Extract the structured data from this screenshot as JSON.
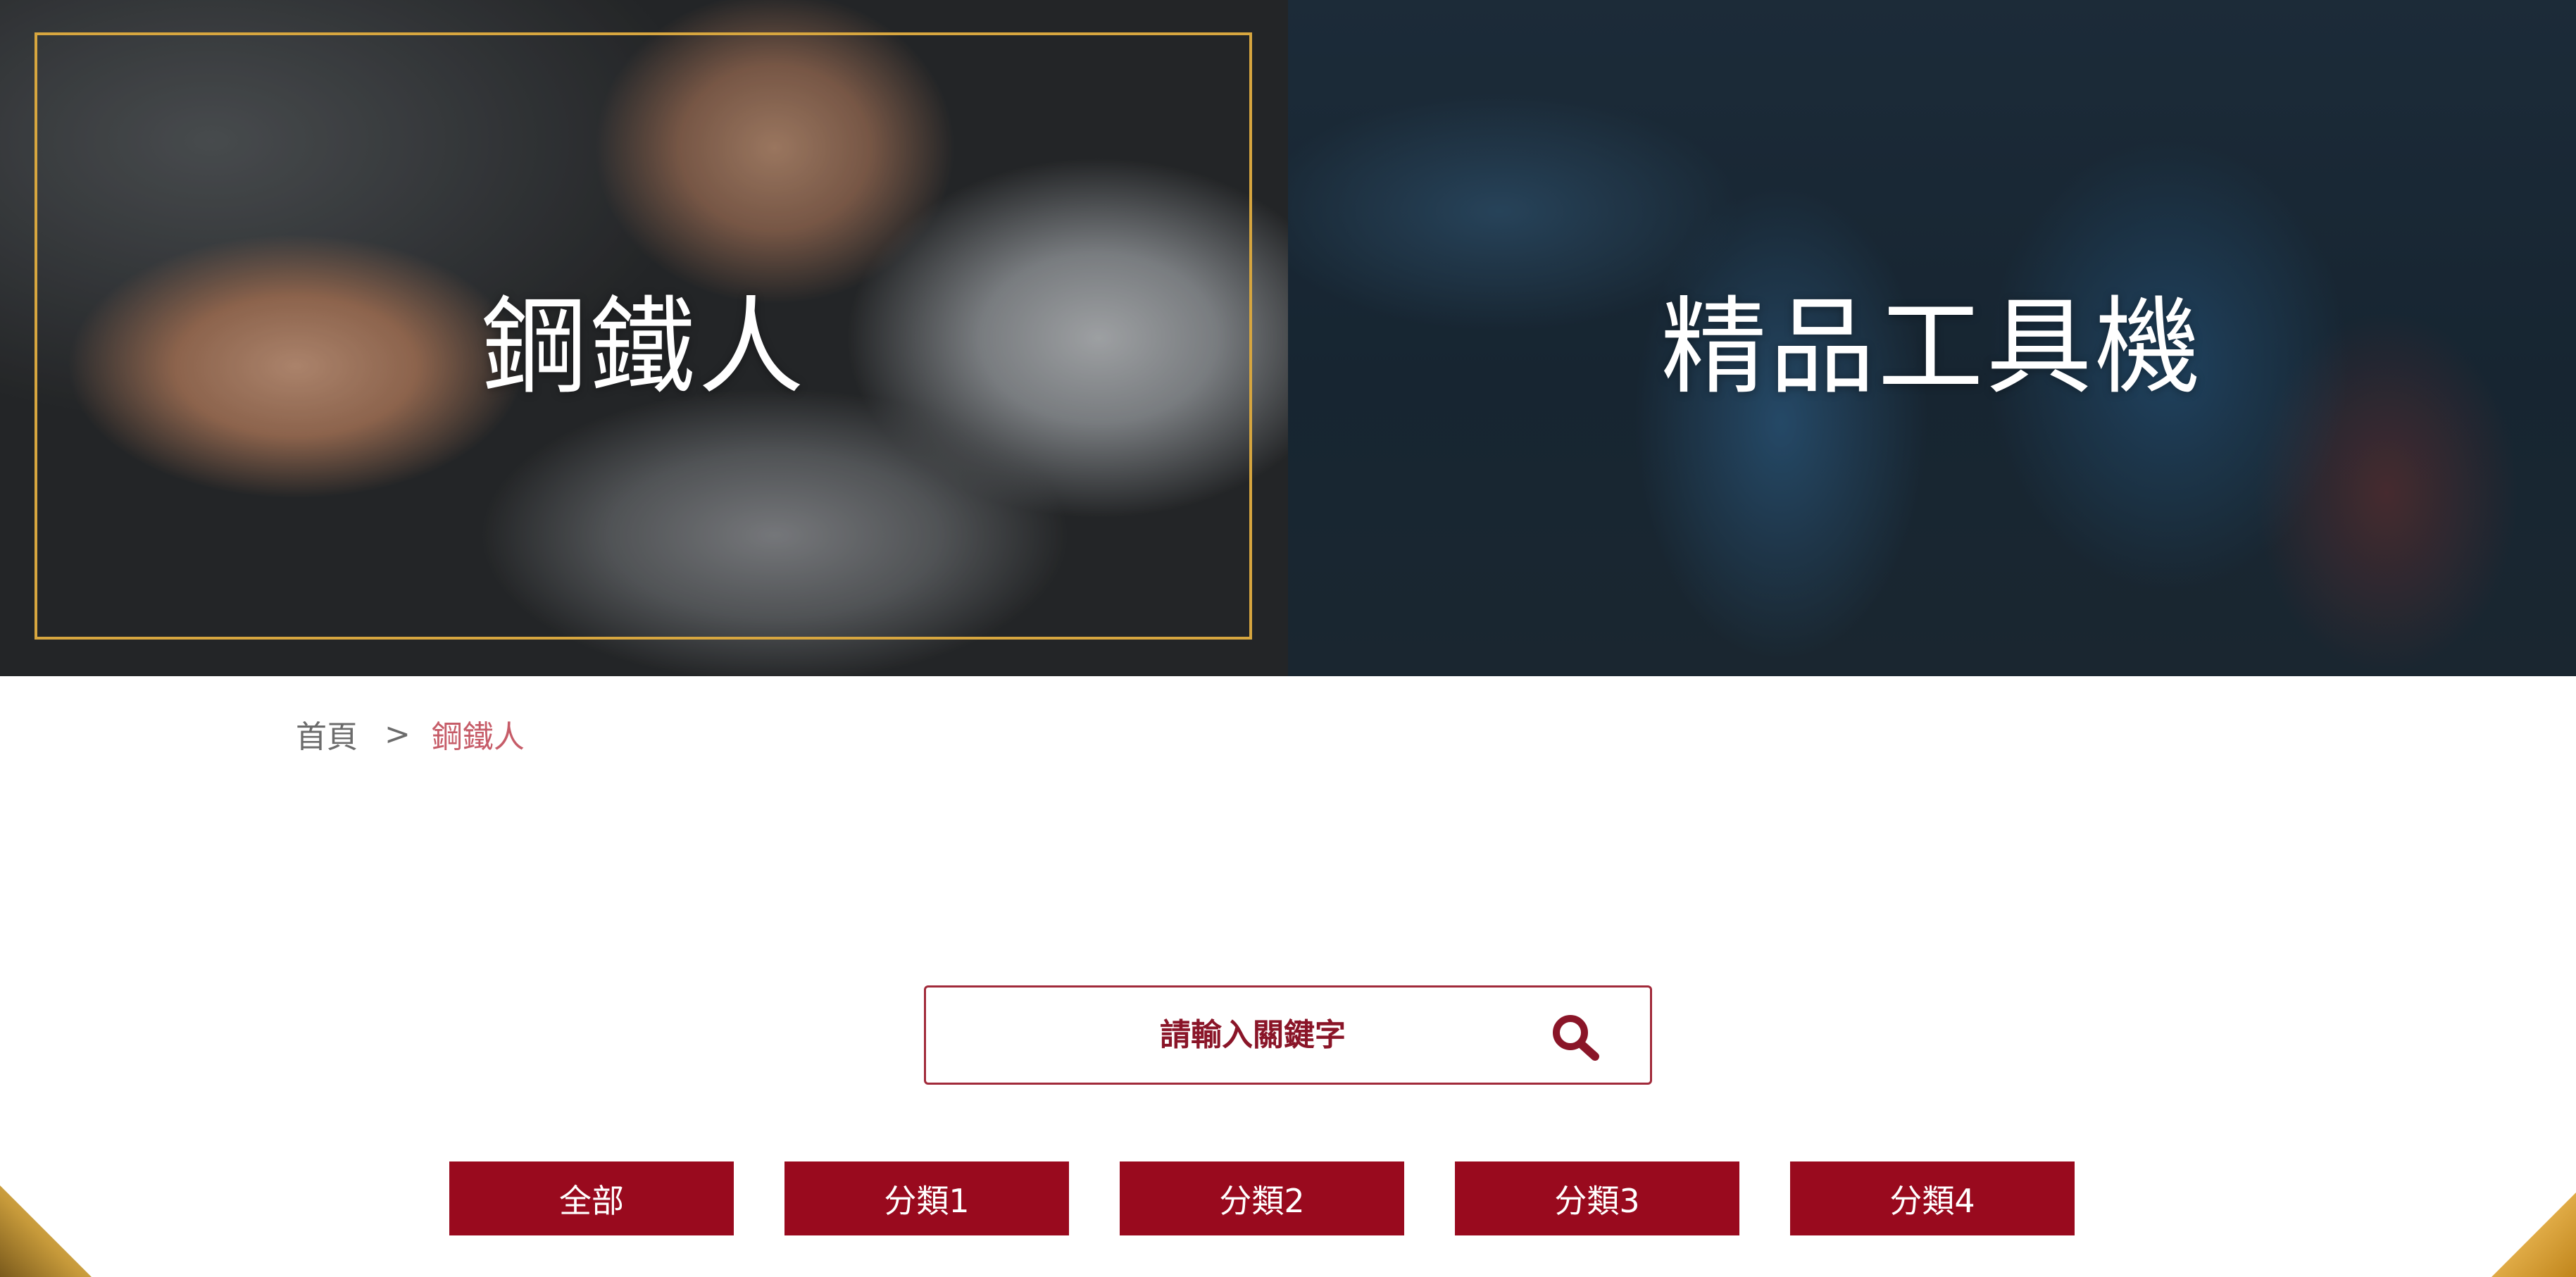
{
  "hero": {
    "left_title": "鋼鐵人",
    "right_title": "精品工具機"
  },
  "breadcrumb": {
    "home": "首頁",
    "separator": ">",
    "current": "鋼鐵人"
  },
  "search": {
    "placeholder": "請輸入關鍵字",
    "icon": "search-icon"
  },
  "categories": [
    {
      "label": "全部"
    },
    {
      "label": "分類1"
    },
    {
      "label": "分類2"
    },
    {
      "label": "分類3"
    },
    {
      "label": "分類4"
    }
  ],
  "colors": {
    "primary_red": "#990a1e",
    "gold_frame": "#d7a63f",
    "breadcrumb_current": "#c65c68"
  }
}
